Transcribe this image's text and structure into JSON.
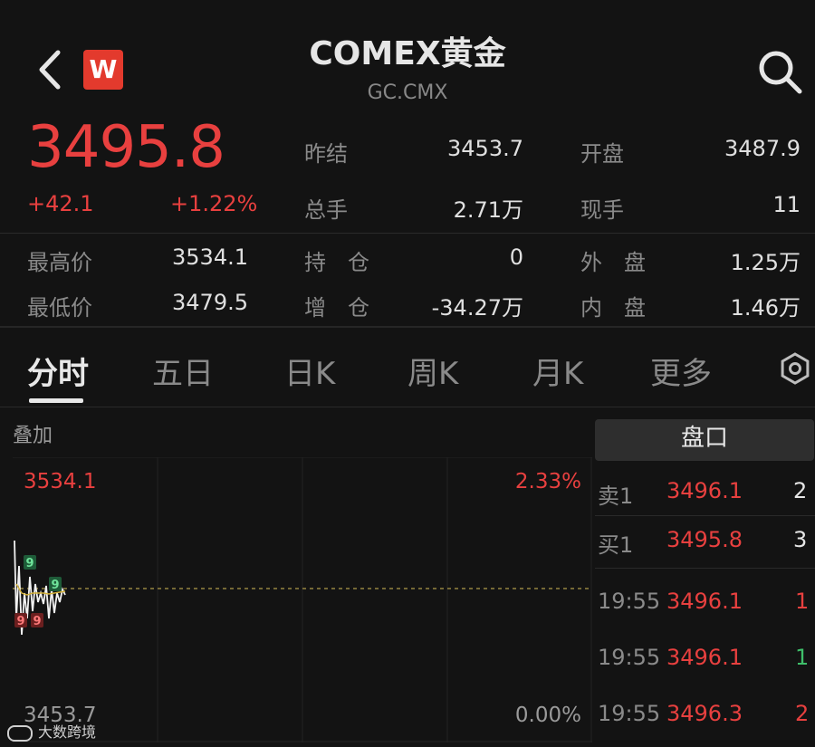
{
  "header": {
    "logo_letter": "W",
    "title": "COMEX黄金",
    "code": "GC.CMX"
  },
  "quote": {
    "price": "3495.8",
    "change": "+42.1",
    "change_pct": "+1.22%",
    "fields": [
      {
        "label": "昨结",
        "value": "3453.7"
      },
      {
        "label": "开盘",
        "value": "3487.9"
      },
      {
        "label": "总手",
        "value": "2.71万"
      },
      {
        "label": "现手",
        "value": "11"
      },
      {
        "label": "最高价",
        "value": "3534.1"
      },
      {
        "label": "持　仓",
        "value": "0"
      },
      {
        "label": "外　盘",
        "value": "1.25万"
      },
      {
        "label": "最低价",
        "value": "3479.5"
      },
      {
        "label": "增　仓",
        "value": "-34.27万"
      },
      {
        "label": "内　盘",
        "value": "1.46万"
      }
    ]
  },
  "tabs": [
    "分时",
    "五日",
    "日K",
    "周K",
    "月K",
    "更多"
  ],
  "chart": {
    "overlay_label": "叠加",
    "top_price": "3534.1",
    "top_pct": "2.33%",
    "bottom_price": "3453.7",
    "bottom_pct": "0.00%",
    "markers": [
      "9",
      "9",
      "9",
      "9"
    ]
  },
  "order_book": {
    "title": "盘口",
    "levels": [
      {
        "label": "卖1",
        "price": "3496.1",
        "volume": "2"
      },
      {
        "label": "买1",
        "price": "3495.8",
        "volume": "3"
      }
    ],
    "trades": [
      {
        "time": "19:55",
        "price": "3496.1",
        "volume": "1",
        "color": "#e8403f"
      },
      {
        "time": "19:55",
        "price": "3496.1",
        "volume": "1",
        "color": "#3fbf6a"
      },
      {
        "time": "19:55",
        "price": "3496.3",
        "volume": "2",
        "color": "#e8403f"
      }
    ]
  },
  "watermark": "大数跨境",
  "colors": {
    "up": "#e8403f",
    "down": "#3fbf6a",
    "background": "#131313"
  }
}
